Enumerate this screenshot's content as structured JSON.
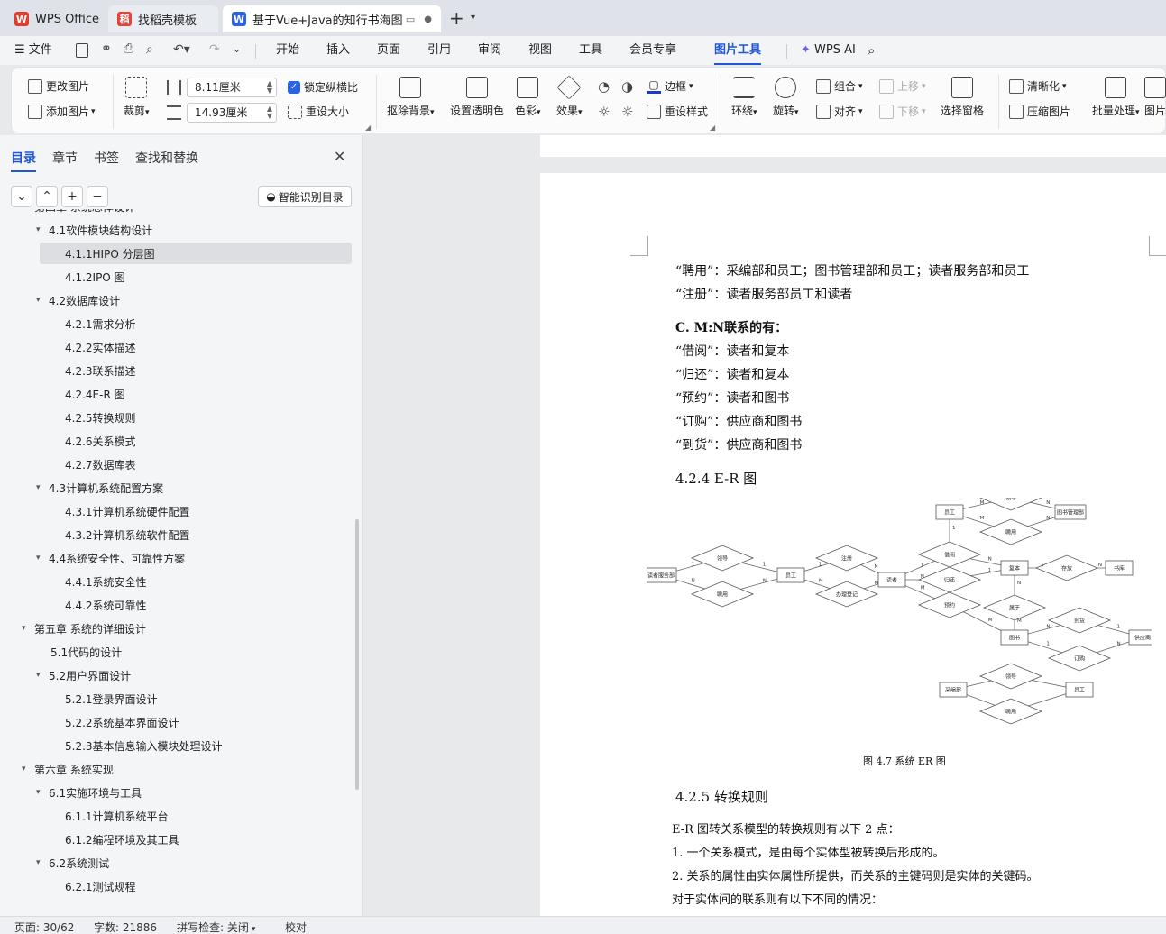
{
  "tabs": [
    {
      "label": "WPS Office",
      "icon": "wps-logo-icon",
      "color": "#e33b2e"
    },
    {
      "label": "找稻壳模板",
      "icon": "docer-icon",
      "color": "#e8403a"
    },
    {
      "label": "基于Vue+Java的知行书海图书",
      "icon": "writer-icon",
      "color": "#2a63e8"
    }
  ],
  "menu": {
    "file": "文件",
    "items": [
      "开始",
      "插入",
      "页面",
      "引用",
      "审阅",
      "视图",
      "工具",
      "会员专享"
    ],
    "active": "图片工具",
    "ai": "WPS AI"
  },
  "ribbon": {
    "change_pic": "更改图片",
    "add_pic": "添加图片",
    "crop": "裁剪",
    "width": "8.11厘米",
    "height": "14.93厘米",
    "lock_ratio": "锁定纵横比",
    "reset_size": "重设大小",
    "remove_bg": "抠除背景",
    "set_transparent": "设置透明色",
    "color": "色彩",
    "effect": "效果",
    "border": "边框",
    "reset_style": "重设样式",
    "wrap": "环绕",
    "rotate": "旋转",
    "group": "组合",
    "align": "对齐",
    "bring_forward": "上移",
    "send_backward": "下移",
    "selection_pane": "选择窗格",
    "sharpen": "清晰化",
    "compress": "压缩图片",
    "batch": "批量处理",
    "picture": "图片"
  },
  "sidebar": {
    "tabs": [
      "目录",
      "章节",
      "书签",
      "查找和替换"
    ],
    "smart_toc": "智能识别目录",
    "toc": [
      {
        "t": "第四章 系统总体设计",
        "l": 0,
        "tri": "▾"
      },
      {
        "t": "4.1软件模块结构设计",
        "l": 1,
        "tri": "▾"
      },
      {
        "t": "4.1.1HIPO 分层图",
        "l": 2,
        "sel": true
      },
      {
        "t": "4.1.2IPO 图",
        "l": 2
      },
      {
        "t": "4.2数据库设计",
        "l": 1,
        "tri": "▾"
      },
      {
        "t": "4.2.1需求分析",
        "l": 2
      },
      {
        "t": "4.2.2实体描述",
        "l": 2
      },
      {
        "t": "4.2.3联系描述",
        "l": 2
      },
      {
        "t": "4.2.4E-R 图",
        "l": 2
      },
      {
        "t": "4.2.5转换规则",
        "l": 2
      },
      {
        "t": "4.2.6关系模式",
        "l": 2
      },
      {
        "t": "4.2.7数据库表",
        "l": 2
      },
      {
        "t": "4.3计算机系统配置方案",
        "l": 1,
        "tri": "▾"
      },
      {
        "t": "4.3.1计算机系统硬件配置",
        "l": 2
      },
      {
        "t": "4.3.2计算机系统软件配置",
        "l": 2
      },
      {
        "t": "4.4系统安全性、可靠性方案",
        "l": 1,
        "tri": "▾"
      },
      {
        "t": "4.4.1系统安全性",
        "l": 2
      },
      {
        "t": "4.4.2系统可靠性",
        "l": 2
      },
      {
        "t": "第五章 系统的详细设计",
        "l": 0,
        "tri": "▾"
      },
      {
        "t": "5.1代码的设计",
        "l": 1
      },
      {
        "t": "5.2用户界面设计",
        "l": 1,
        "tri": "▾"
      },
      {
        "t": "5.2.1登录界面设计",
        "l": 2
      },
      {
        "t": "5.2.2系统基本界面设计",
        "l": 2
      },
      {
        "t": "5.2.3基本信息输入模块处理设计",
        "l": 2
      },
      {
        "t": "第六章 系统实现",
        "l": 0,
        "tri": "▾"
      },
      {
        "t": "6.1实施环境与工具",
        "l": 1,
        "tri": "▾"
      },
      {
        "t": "6.1.1计算机系统平台",
        "l": 2
      },
      {
        "t": "6.1.2编程环境及其工具",
        "l": 2
      },
      {
        "t": "6.2系统测试",
        "l": 1,
        "tri": "▾"
      },
      {
        "t": "6.2.1测试规程",
        "l": 2
      }
    ]
  },
  "doc": {
    "lines1": [
      "“聘用”：采编部和员工；图书管理部和员工；读者服务部和员工",
      "“注册”：读者服务部员工和读者"
    ],
    "mn_heading": "C. M:N联系的有：",
    "lines2": [
      "“借阅”：读者和复本",
      "“归还”：读者和复本",
      "“预约”：读者和图书",
      "“订购”：供应商和图书",
      "“到货”：供应商和图书"
    ],
    "h424": "4.2.4 E-R 图",
    "caption": "图 4.7  系统 ER 图",
    "h425": "4.2.5 转换规则",
    "lines3": [
      "E-R 图转关系模型的转换规则有以下 2 点：",
      "1. 一个关系模式，是由每个实体型被转换后形成的。",
      "2. 关系的属性由实体属性所提供，而关系的主键码则是实体的关键码。",
      "对于实体间的联系则有以下不同的情况："
    ],
    "er": {
      "entities": [
        "读者服务部",
        "员工",
        "读者",
        "员工",
        "图书管理部",
        "复本",
        "书库",
        "图书",
        "供应商",
        "采编部",
        "员工"
      ],
      "relations": [
        "领导",
        "聘用",
        "注册",
        "办理登记",
        "领导",
        "聘用",
        "借阅",
        "归还",
        "预约",
        "存放",
        "属于",
        "到货",
        "订购",
        "领导",
        "聘用"
      ],
      "cards": [
        "1",
        "N",
        "1",
        "N",
        "1",
        "M",
        "N",
        "M",
        "1",
        "N",
        "M",
        "M",
        "M",
        "N",
        "N",
        "1",
        "N",
        "1",
        "1",
        "N",
        "N",
        "M",
        "M",
        "N",
        "1",
        "1",
        "N"
      ]
    }
  },
  "status": {
    "page": "页面: 30/62",
    "words": "字数: 21886",
    "spell": "拼写检查: 关闭",
    "proof": "校对"
  }
}
